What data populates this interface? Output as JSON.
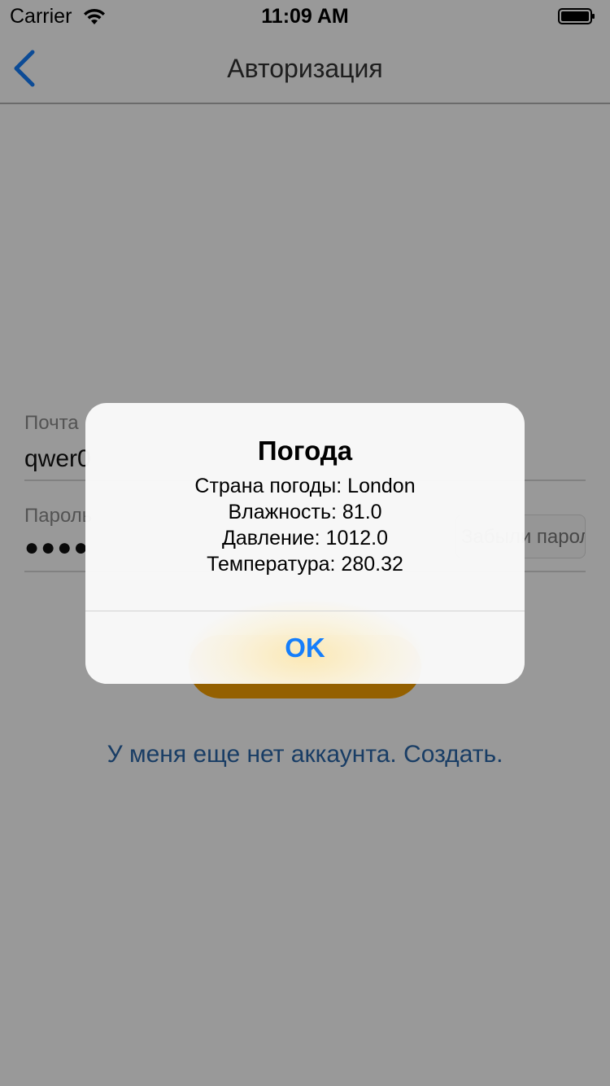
{
  "status_bar": {
    "carrier": "Carrier",
    "time": "11:09 AM"
  },
  "nav": {
    "title": "Авторизация",
    "back_icon": "chevron-left-icon"
  },
  "form": {
    "email_label": "Почта",
    "email_value": "qwer0",
    "password_label": "Пароль",
    "password_value": "●●●●",
    "forgot_label": "Забыли пароль?",
    "signup_link": "У меня еще нет аккаунта. Создать."
  },
  "alert": {
    "title": "Погода",
    "lines": [
      "Страна погоды: London",
      "Влажность: 81.0",
      "Давление: 1012.0",
      "Температура: 280.32"
    ],
    "ok_label": "OK"
  },
  "colors": {
    "accent": "#157efb",
    "login_button": "#f7a100",
    "link": "#2a67a8",
    "dim_overlay": "rgba(0,0,0,0.4)"
  }
}
